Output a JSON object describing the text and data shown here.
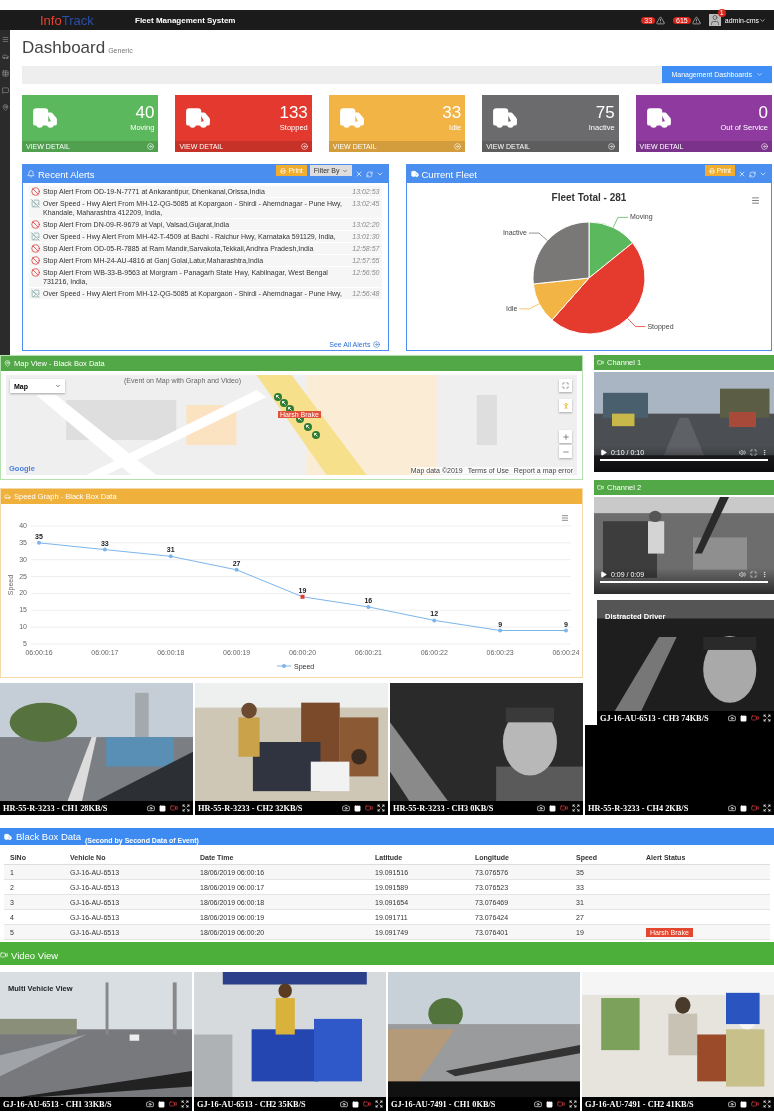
{
  "header": {
    "logo_primary": "Info",
    "logo_secondary": "Track",
    "title": "Fleet Management System",
    "notifications": [
      {
        "count": "33"
      },
      {
        "count": "615"
      }
    ],
    "user": {
      "name": "admin-cms",
      "badge": "1"
    }
  },
  "page": {
    "title": "Dashboard",
    "subtitle": "Generic",
    "menu_button": "Management Dashboards"
  },
  "status_cards": [
    {
      "count": "40",
      "label": "Moving",
      "color": "#5cb85c",
      "link": "VIEW DETAIL"
    },
    {
      "count": "133",
      "label": "Stopped",
      "color": "#e4392e",
      "link": "VIEW DETAIL"
    },
    {
      "count": "33",
      "label": "Idle",
      "color": "#f3b446",
      "link": "VIEW DETAIL"
    },
    {
      "count": "75",
      "label": "Inactive",
      "color": "#6b6b6d",
      "link": "VIEW DETAIL"
    },
    {
      "count": "0",
      "label": "Out of Service",
      "color": "#8e3a9f",
      "link": "VIEW DETAIL"
    }
  ],
  "recent_alerts": {
    "title": "Recent Alerts",
    "print": "Print",
    "filter": "Filter By",
    "more": "See All Alerts",
    "items": [
      {
        "kind": "stop",
        "text": "Stop Alert From OD-19-N-7771 at Ankarantipur, Dhenkanal,Orissa,India",
        "time": "13:02:53"
      },
      {
        "kind": "speed",
        "text": "Over Speed - Hwy Alert From MH-12-QG-5085 at Kopargaon - Shirdi - Ahemdnagar - Pune Hwy, Khandale, Maharashtra 412209, India,",
        "time": "13:02:45"
      },
      {
        "kind": "stop",
        "text": "Stop Alert From DN-09-R-9679 at Vapi, Valsad,Gujarat,India",
        "time": "13:02:20"
      },
      {
        "kind": "speed",
        "text": "Over Speed - Hwy Alert From MH-42-T-4509 at Bachi - Raichur Hwy, Karnataka 591129, India,",
        "time": "13:01:30"
      },
      {
        "kind": "stop",
        "text": "Stop Alert From OD-05-R-7885 at Ram Mandir,Sarvakota,Tekkali,Andhra Pradesh,India",
        "time": "12:58:57"
      },
      {
        "kind": "stop",
        "text": "Stop Alert From MH-24-AU-4816 at Ganj Golai,Latur,Maharashtra,India",
        "time": "12:57:55"
      },
      {
        "kind": "stop",
        "text": "Stop Alert From WB-33-B-9563 at Morgram - Panagarh State Hwy, Kabilnagar, West Bengal 731216, India,",
        "time": "12:56:50"
      },
      {
        "kind": "speed",
        "text": "Over Speed - Hwy Alert From MH-12-QG-5085 at Kopargaon - Shirdi - Ahemdnagar - Pune Hwy,",
        "time": "12:56:48"
      }
    ]
  },
  "current_fleet": {
    "title": "Current Fleet",
    "print": "Print",
    "chart_data": {
      "type": "pie",
      "title": "Fleet Total - 281",
      "categories": [
        "Moving",
        "Stopped",
        "Idle",
        "Inactive"
      ],
      "values": [
        14.2,
        47.3,
        11.8,
        26.7
      ]
    }
  },
  "map_view": {
    "title": "Map View - Black Box Data",
    "note": "(Event on Map with Graph and Video)",
    "map_type": "Map",
    "marker_label": "Harsh Brake",
    "brand": "Google",
    "footer": [
      "Map data ©2019",
      "Terms of Use",
      "Report a map error"
    ]
  },
  "speed_graph": {
    "title": "Speed Graph - Black Box Data",
    "chart_data": {
      "type": "line",
      "ylabel": "Speed",
      "categories": [
        "06:00:16",
        "06:00:17",
        "06:00:18",
        "06:00:19",
        "06:00:20",
        "06:00:21",
        "06:00:22",
        "06:00:23",
        "06:00:24"
      ],
      "series": [
        {
          "name": "Speed",
          "color": "#7cb5ec",
          "values": [
            35,
            33,
            31,
            27,
            19,
            16,
            12,
            9,
            9
          ]
        }
      ],
      "ylim": [
        5,
        40
      ],
      "yticks": [
        5,
        10,
        15,
        20,
        25,
        30,
        35,
        40
      ],
      "grid": true,
      "data_labels": true,
      "annotations": [
        {
          "x": "06:00:20"
        }
      ]
    }
  },
  "channels": [
    {
      "title": "Channel 1",
      "time": "0:10 / 0:10",
      "level": 1
    },
    {
      "title": "Channel 2",
      "time": "0:09 / 0:09",
      "level": 1
    }
  ],
  "event_camera": {
    "overlay": "Distracted Driver",
    "caption": "GJ-16-AU-6513 - CH3 74KB/S"
  },
  "camera_strip": [
    {
      "caption": "HR-55-R-3233 - CH1 28KB/S"
    },
    {
      "caption": "HR-55-R-3233 - CH2 32KB/S"
    },
    {
      "caption": "HR-55-R-3233 - CH3 0KB/S"
    },
    {
      "caption": "HR-55-R-3233 - CH4 2KB/S"
    }
  ],
  "black_box": {
    "title": "Black Box Data",
    "subtitle": "(Second by Second Data of Event)",
    "columns": [
      "SlNo",
      "Vehicle No",
      "Date Time",
      "Latitude",
      "Longitude",
      "Speed",
      "Alert Status"
    ],
    "rows": [
      {
        "cells": [
          "1",
          "GJ-16-AU-6513",
          "18/06/2019 06:00:16",
          "19.091516",
          "73.076576",
          "35"
        ]
      },
      {
        "cells": [
          "2",
          "GJ-16-AU-6513",
          "18/06/2019 06:00:17",
          "19.091589",
          "73.076523",
          "33"
        ]
      },
      {
        "cells": [
          "3",
          "GJ-16-AU-6513",
          "18/06/2019 06:00:18",
          "19.091654",
          "73.076469",
          "31"
        ]
      },
      {
        "cells": [
          "4",
          "GJ-16-AU-6513",
          "18/06/2019 06:00:19",
          "19.091711",
          "73.076424",
          "27"
        ]
      },
      {
        "cells": [
          "5",
          "GJ-16-AU-6513",
          "18/06/2019 06:00:20",
          "19.091749",
          "73.076401",
          "19"
        ],
        "alert": "Harsh Brake"
      }
    ]
  },
  "video_view": {
    "title": "Video View",
    "overlay": "Multi Vehicle View",
    "tiles": [
      {
        "caption": "GJ-16-AU-6513 - CH1 33KB/S"
      },
      {
        "caption": "GJ-16-AU-6513 - CH2 35KB/S"
      },
      {
        "caption": "GJ-16-AU-7491 - CH1 0KB/S"
      },
      {
        "caption": "GJ-16-AU-7491 - CH2 41KB/S"
      }
    ]
  }
}
